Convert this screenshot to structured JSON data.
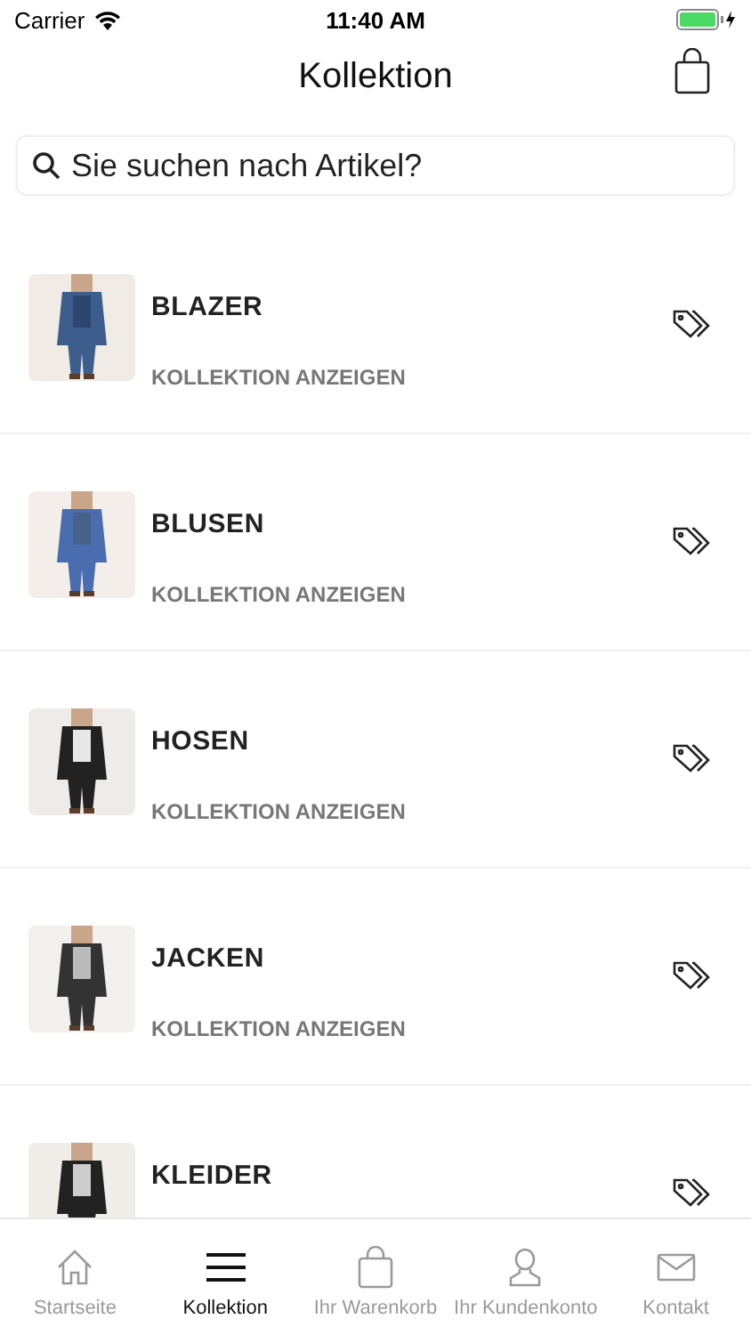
{
  "status_bar": {
    "carrier": "Carrier",
    "time": "11:40 AM"
  },
  "header": {
    "title": "Kollektion"
  },
  "search": {
    "placeholder": "Sie suchen nach Artikel?"
  },
  "categories": [
    {
      "title": "BLAZER",
      "subtitle": "KOLLEKTION ANZEIGEN"
    },
    {
      "title": "BLUSEN",
      "subtitle": "KOLLEKTION ANZEIGEN"
    },
    {
      "title": "HOSEN",
      "subtitle": "KOLLEKTION ANZEIGEN"
    },
    {
      "title": "JACKEN",
      "subtitle": "KOLLEKTION ANZEIGEN"
    },
    {
      "title": "KLEIDER"
    }
  ],
  "tab_bar": [
    {
      "label": "Startseite",
      "selected": false
    },
    {
      "label": "Kollektion",
      "selected": true
    },
    {
      "label": "Ihr Warenkorb",
      "selected": false
    },
    {
      "label": "Ihr Kundenkonto",
      "selected": false
    },
    {
      "label": "Kontakt",
      "selected": false
    }
  ]
}
